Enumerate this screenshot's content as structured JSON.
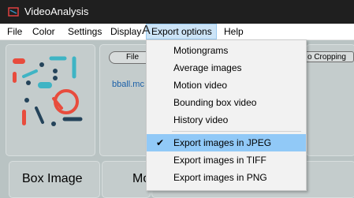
{
  "window": {
    "title": "VideoAnalysis"
  },
  "menubar": {
    "items": [
      "File",
      "Color",
      "Settings",
      "Display",
      "Export options",
      "Help"
    ]
  },
  "dropdown": {
    "items": [
      "Motiongrams",
      "Average images",
      "Motion video",
      "Bounding box video",
      "History video"
    ],
    "export_items": [
      "Export images in JPEG",
      "Export images in TIFF",
      "Export images in PNG"
    ],
    "checked_item": "Export images in JPEG"
  },
  "main": {
    "file_button": "File",
    "cropping_button": "o Cropping",
    "filename": "bball.mc",
    "box_image_label": "Box Image",
    "mo_label": "Mo",
    "panel_peek": "A"
  },
  "colors": {
    "accent": "#91c9f7",
    "menu_highlight": "#cce4f7",
    "background": "#b9c3c3",
    "titlebar": "#1f1f1f"
  },
  "icons": {
    "app": "app-logo-icon",
    "check": "checkmark-icon"
  }
}
